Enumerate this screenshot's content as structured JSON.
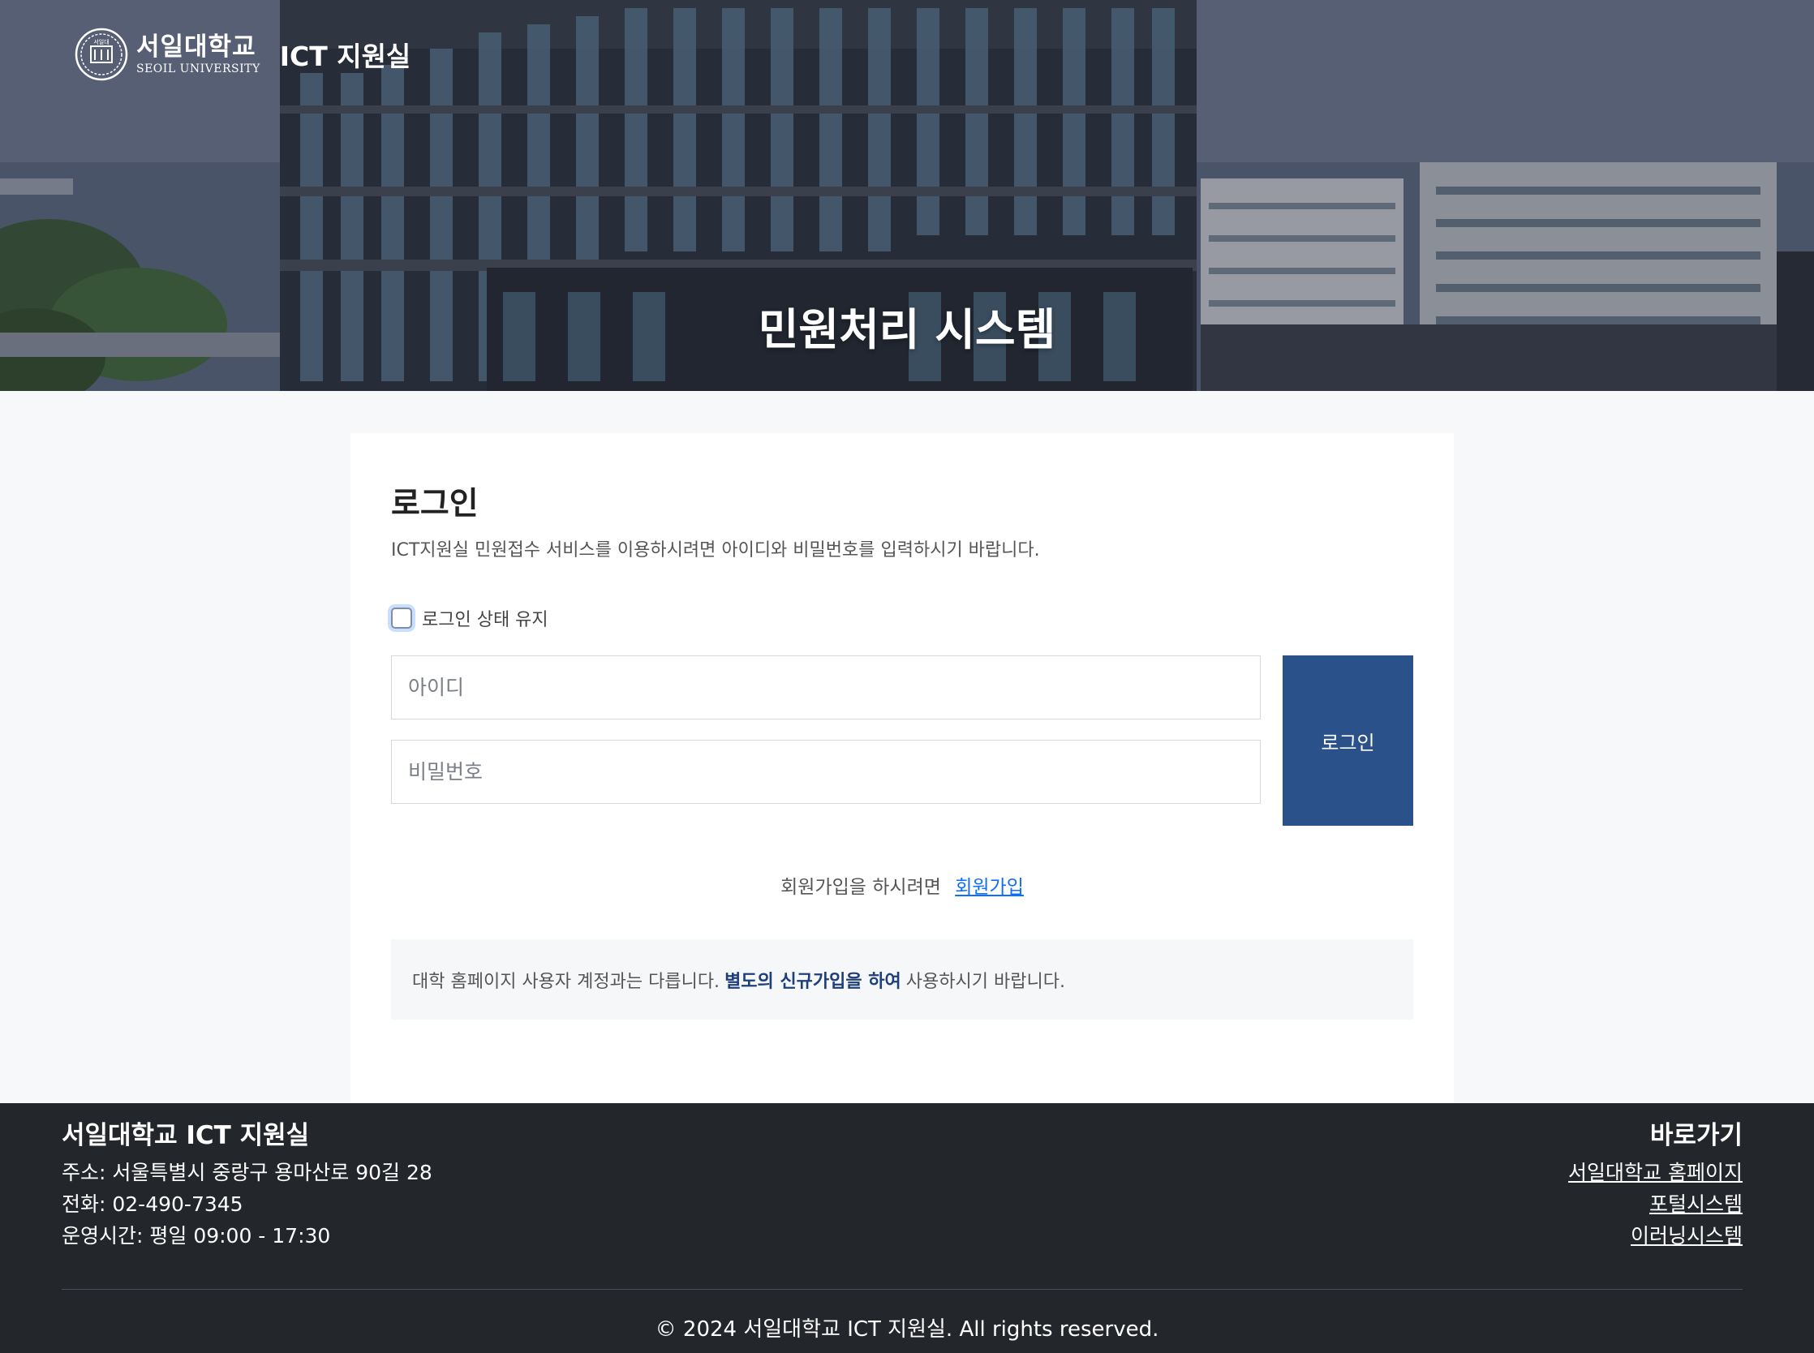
{
  "header": {
    "brand_korean": "서일대학교",
    "brand_english": "SEOIL UNIVERSITY",
    "emblem_text": "서일대",
    "department": "ICT 지원실",
    "page_title": "민원처리 시스템"
  },
  "login": {
    "heading": "로그인",
    "description": "ICT지원실 민원접수 서비스를 이용하시려면 아이디와 비밀번호를 입력하시기 바랍니다.",
    "remember_label": "로그인 상태 유지",
    "remember_checked": false,
    "id_placeholder": "아이디",
    "id_value": "",
    "password_placeholder": "비밀번호",
    "password_value": "",
    "button_label": "로그인",
    "signup_prompt": "회원가입을 하시려면",
    "signup_link": "회원가입",
    "notice_prefix": "대학 홈페이지 사용자 계정과는 다릅니다.",
    "notice_emphasis": "별도의 신규가입을 하여",
    "notice_suffix": "사용하시기 바랍니다."
  },
  "footer": {
    "title": "서일대학교 ICT 지원실",
    "address": "주소: 서울특별시 중랑구 용마산로 90길 28",
    "phone": "전화: 02-490-7345",
    "hours": "운영시간: 평일 09:00 - 17:30",
    "quick_links_title": "바로가기",
    "quick_links": [
      "서일대학교 홈페이지",
      "포털시스템",
      "이러닝시스템"
    ],
    "copyright": "© 2024 서일대학교 ICT 지원실. All rights reserved."
  },
  "colors": {
    "primary_button": "#2b518b",
    "link": "#0d6efd",
    "notice_emphasis": "#1f3f7a",
    "footer_bg": "#23262b",
    "page_bg": "#f7f8fa"
  }
}
